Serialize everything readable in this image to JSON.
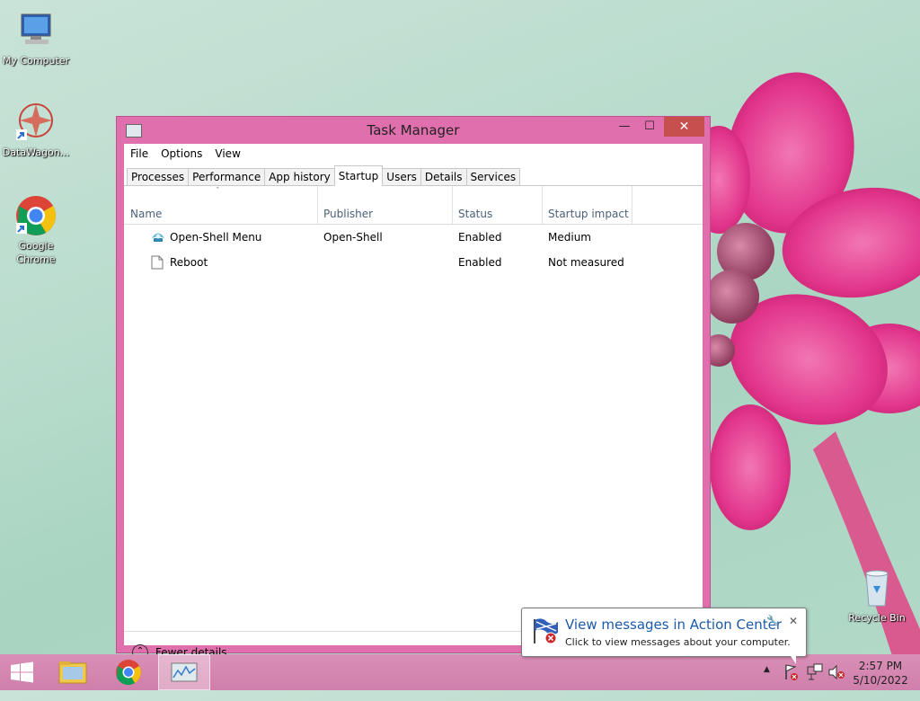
{
  "desktop": {
    "icons": [
      {
        "label": "My Computer",
        "icon": "computer-icon"
      },
      {
        "label": "DataWagon...",
        "icon": "datawagon-icon"
      },
      {
        "label": "Google Chrome",
        "icon": "chrome-icon"
      },
      {
        "label": "Recycle Bin",
        "icon": "recycle-bin-icon"
      }
    ]
  },
  "window": {
    "title": "Task Manager",
    "controls": {
      "minimize": "—",
      "maximize": "☐",
      "close": "✕"
    },
    "menu": [
      "File",
      "Options",
      "View"
    ],
    "tabs": [
      "Processes",
      "Performance",
      "App history",
      "Startup",
      "Users",
      "Details",
      "Services"
    ],
    "active_tab": "Startup",
    "columns": [
      "Name",
      "Publisher",
      "Status",
      "Startup impact"
    ],
    "sort_indicator": "ˆ",
    "rows": [
      {
        "name": "Open-Shell Menu",
        "publisher": "Open-Shell",
        "status": "Enabled",
        "impact": "Medium",
        "icon": "open-shell-icon"
      },
      {
        "name": "Reboot",
        "publisher": "",
        "status": "Enabled",
        "impact": "Not measured",
        "icon": "file-icon"
      }
    ],
    "fewer_details": "Fewer details",
    "fewer_details_glyph": "⌃"
  },
  "taskbar": {
    "clock_time": "2:57 PM",
    "clock_date": "5/10/2022",
    "tray_arrow": "▲"
  },
  "balloon": {
    "title": "View messages in Action Center",
    "body": "Click to view messages about your computer.",
    "close": "✕",
    "pin": "🔧"
  },
  "colors": {
    "window_frame": "#e06fae",
    "taskbar": "#d98fb7",
    "close_button": "#c7504f",
    "link_blue": "#1c5aa8"
  }
}
